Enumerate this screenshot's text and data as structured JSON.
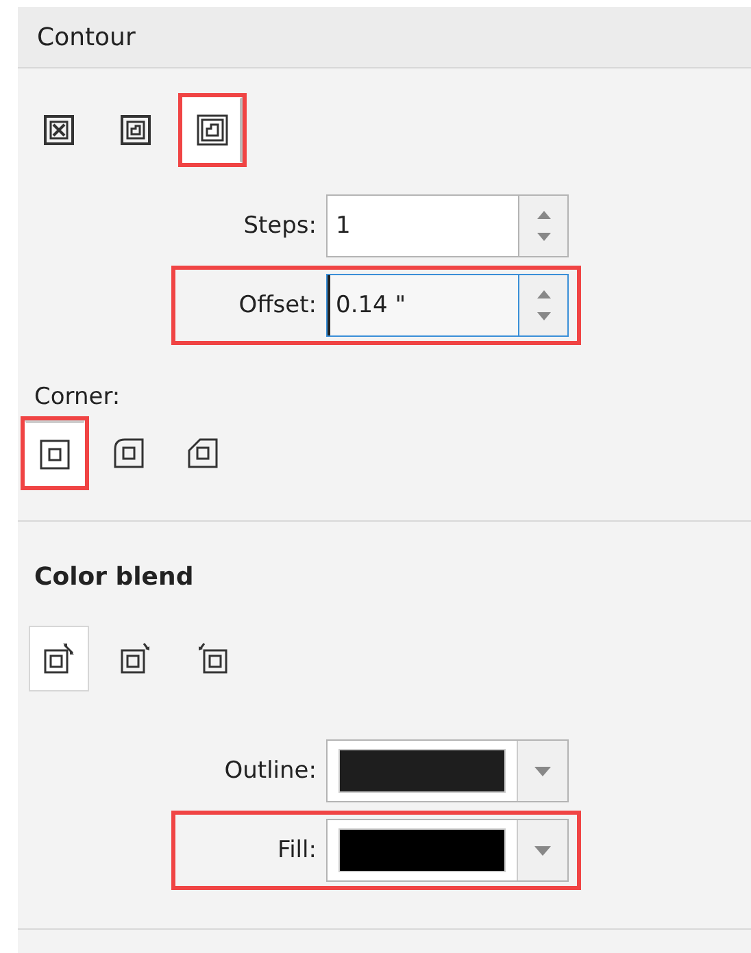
{
  "header": {
    "title": "Contour"
  },
  "contour_types": [
    {
      "kind": "center",
      "selected": false,
      "highlighted": false
    },
    {
      "kind": "inside",
      "selected": false,
      "highlighted": false
    },
    {
      "kind": "outside",
      "selected": true,
      "highlighted": true
    }
  ],
  "steps": {
    "label": "Steps:",
    "value": "1",
    "focused": false,
    "highlighted": false
  },
  "offset": {
    "label": "Offset:",
    "value": "0.14 \"",
    "focused": true,
    "highlighted": true
  },
  "corner": {
    "label": "Corner:",
    "options": [
      {
        "kind": "miter",
        "selected": true,
        "highlighted": true
      },
      {
        "kind": "round",
        "selected": false,
        "highlighted": false
      },
      {
        "kind": "bevel",
        "selected": false,
        "highlighted": false
      }
    ]
  },
  "color_blend": {
    "title": "Color blend",
    "options": [
      {
        "kind": "linear",
        "selected": true
      },
      {
        "kind": "clockwise",
        "selected": false
      },
      {
        "kind": "counterclockwise",
        "selected": false
      }
    ],
    "outline": {
      "label": "Outline:",
      "color": "#1e1e1e",
      "highlighted": false
    },
    "fill": {
      "label": "Fill:",
      "color": "#000000",
      "highlighted": true
    }
  }
}
